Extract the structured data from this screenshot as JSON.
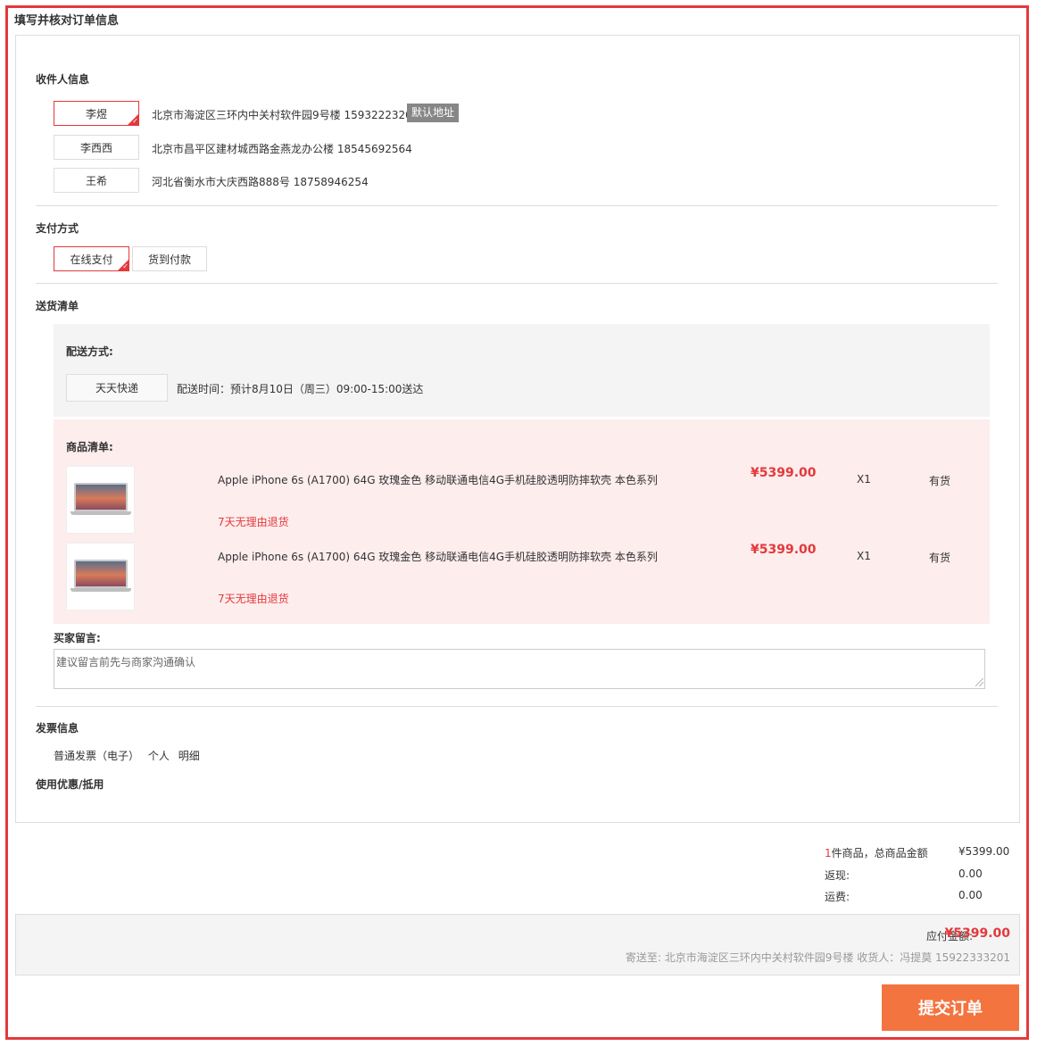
{
  "page": {
    "title": "填写并核对订单信息"
  },
  "receiver": {
    "section_title": "收件人信息",
    "addresses": [
      {
        "name": "李煜",
        "detail": "北京市海淀区三环内中关村软件园9号楼 15932223201",
        "selected": true
      },
      {
        "name": "李西西",
        "detail": "北京市昌平区建材城西路金燕龙办公楼 18545692564",
        "selected": false
      },
      {
        "name": "王希",
        "detail": "河北省衡水市大庆西路888号 18758946254",
        "selected": false
      }
    ],
    "default_badge": "默认地址"
  },
  "payment": {
    "section_title": "支付方式",
    "options": [
      {
        "label": "在线支付",
        "selected": true
      },
      {
        "label": "货到付款",
        "selected": false
      }
    ]
  },
  "delivery": {
    "section_title": "送货清单",
    "method_title": "配送方式:",
    "courier": "天天快递",
    "time": "配送时间：预计8月10日（周三）09:00-15:00送达",
    "goods_title": "商品清单:",
    "items": [
      {
        "name": "Apple iPhone 6s (A1700) 64G 玫瑰金色 移动联通电信4G手机硅胶透明防摔软壳 本色系列",
        "return_policy": "7天无理由退货",
        "price": "¥5399.00",
        "qty": "X1",
        "stock": "有货",
        "image": "laptop-thumbnail"
      },
      {
        "name": "Apple iPhone 6s (A1700) 64G 玫瑰金色 移动联通电信4G手机硅胶透明防摔软壳 本色系列",
        "return_policy": "7天无理由退货",
        "price": "¥5399.00",
        "qty": "X1",
        "stock": "有货",
        "image": "laptop-thumbnail"
      }
    ]
  },
  "message": {
    "label": "买家留言:",
    "placeholder": "建议留言前先与商家沟通确认"
  },
  "invoice": {
    "section_title": "发票信息",
    "type": "普通发票（电子）",
    "title": "个人",
    "content": "明细"
  },
  "coupon": {
    "section_title": "使用优惠/抵用"
  },
  "summary": {
    "count": "1",
    "count_suffix": "件商品，总商品金额",
    "total": "¥5399.00",
    "cashback_label": "返现:",
    "cashback": "0.00",
    "freight_label": "运费:",
    "freight": "0.00"
  },
  "payable": {
    "label": "应付金额:",
    "amount": "¥5399.00",
    "ship_to": "寄送至: 北京市海淀区三环内中关村软件园9号楼 收货人：冯提莫 15922333201"
  },
  "submit_label": "提交订单",
  "colors": {
    "accent": "#e4393c",
    "submit": "#f3743f"
  }
}
